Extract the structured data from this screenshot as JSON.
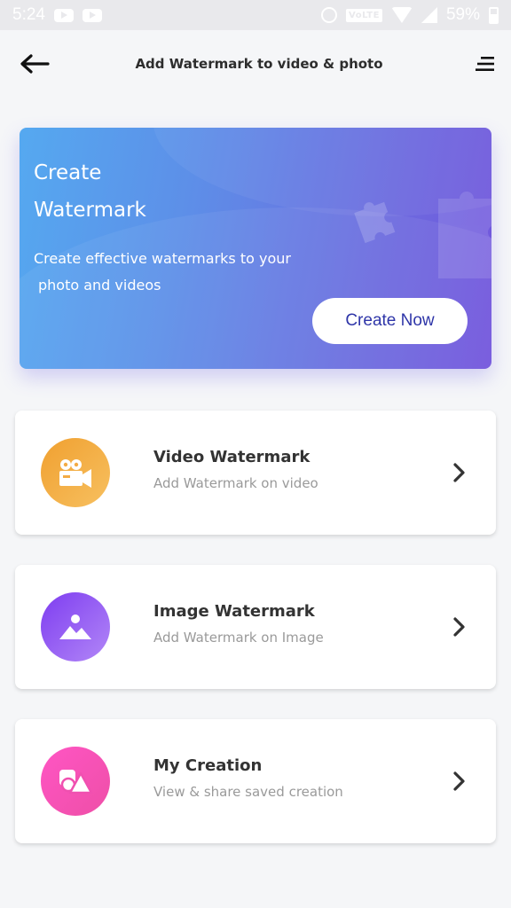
{
  "status_bar": {
    "time": "5:24",
    "network_label": "VoLTE",
    "battery": "59%",
    "icons": [
      "youtube-icon",
      "youtube-icon",
      "alarm-icon",
      "volte-icon",
      "wifi-icon",
      "signal-icon",
      "battery-icon"
    ]
  },
  "app_bar": {
    "title": "Add Watermark to video & photo",
    "back_icon": "back-arrow-icon",
    "menu_icon": "menu-icon"
  },
  "banner": {
    "title_line1": "Create",
    "title_line2": "Watermark",
    "desc_line1": "Create effective watermarks to your",
    "desc_line2": "photo and videos",
    "button_label": "Create Now",
    "gradient_start": "#55a9f0",
    "gradient_end": "#7255dc",
    "button_text_color": "#2e35a8"
  },
  "cards": [
    {
      "title": "Video Watermark",
      "subtitle": "Add Watermark on video",
      "icon": "video-camera-icon",
      "color": "#f2a43a"
    },
    {
      "title": "Image Watermark",
      "subtitle": "Add Watermark on Image",
      "icon": "image-icon",
      "color": "#8c4ef2"
    },
    {
      "title": "My Creation",
      "subtitle": "View & share saved creation",
      "icon": "shapes-icon",
      "color": "#f552b6"
    }
  ]
}
